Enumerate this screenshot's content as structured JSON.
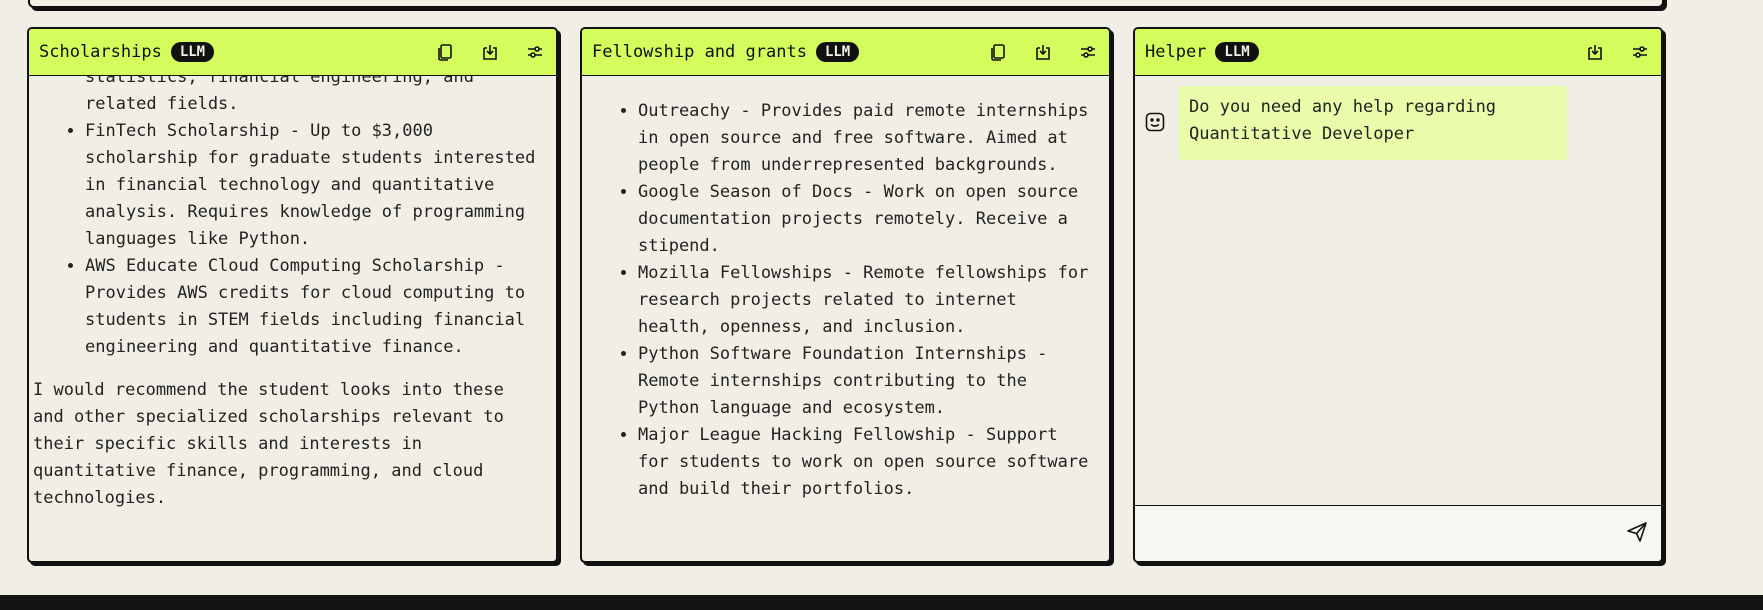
{
  "panels": [
    {
      "title": "Scholarships",
      "badge": "LLM",
      "items": [
        "statistics, financial engineering, and related fields.",
        "FinTech Scholarship - Up to $3,000 scholarship for graduate students interested in financial technology and quantitative analysis. Requires knowledge of programming languages like Python.",
        "AWS Educate Cloud Computing Scholarship - Provides AWS credits for cloud computing to students in STEM fields including financial engineering and quantitative finance."
      ],
      "paragraph": "I would recommend the student looks into these and other specialized scholarships relevant to their specific skills and interests in quantitative finance, programming, and cloud technologies."
    },
    {
      "title": "Fellowship and grants",
      "badge": "LLM",
      "items": [
        "Outreachy - Provides paid remote internships in open source and free software. Aimed at people from underrepresented backgrounds.",
        "Google Season of Docs - Work on open source documentation projects remotely. Receive a stipend.",
        "Mozilla Fellowships - Remote fellowships for research projects related to internet health, openness, and inclusion.",
        "Python Software Foundation Internships - Remote internships contributing to the Python language and ecosystem.",
        "Major League Hacking Fellowship - Support for students to work on open source software and build their portfolios."
      ]
    },
    {
      "title": "Helper",
      "badge": "LLM",
      "message": "Do you need any help regarding Quantitative Developer",
      "input_placeholder": ""
    }
  ],
  "icons": {
    "copy": "copy-icon",
    "export": "export-icon",
    "settings": "sliders-icon",
    "bot": "bot-face-icon",
    "send": "send-icon"
  },
  "colors": {
    "header": "#d4fc5c",
    "background": "#f1efe5",
    "bubble": "#e8fcaa",
    "border": "#111111"
  }
}
